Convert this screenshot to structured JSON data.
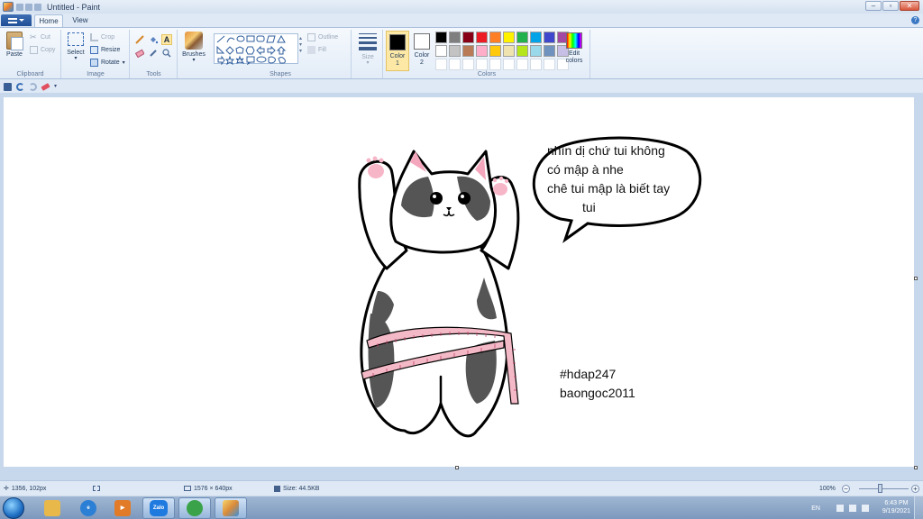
{
  "window": {
    "title": "Untitled - Paint",
    "controls": {
      "minimize": "–",
      "maximize": "▫",
      "close": "✕"
    }
  },
  "tabs": {
    "home": "Home",
    "view": "View"
  },
  "ribbon": {
    "clipboard": {
      "paste": "Paste",
      "cut": "Cut",
      "copy": "Copy",
      "label": "Clipboard"
    },
    "image": {
      "select": "Select",
      "crop": "Crop",
      "resize": "Resize",
      "rotate": "Rotate",
      "label": "Image"
    },
    "tools": {
      "label": "Tools",
      "text_tool": "A"
    },
    "brushes": {
      "label": "Brushes"
    },
    "shapes": {
      "outline": "Outline",
      "fill": "Fill",
      "label": "Shapes"
    },
    "size": {
      "label": "Size"
    },
    "colors": {
      "color1": "Color 1",
      "color2": "Color 2",
      "edit": "Edit colors",
      "label": "Colors",
      "color1_value": "#000000",
      "color2_value": "#ffffff",
      "palette": [
        "#000000",
        "#7f7f7f",
        "#880015",
        "#ed1c24",
        "#ff7f27",
        "#fff200",
        "#22b14c",
        "#00a2e8",
        "#3f48cc",
        "#a349a4",
        "#ffffff",
        "#c3c3c3",
        "#b97a57",
        "#ffaec9",
        "#ffc90e",
        "#efe4b0",
        "#b5e61d",
        "#99d9ea",
        "#7092be",
        "#c8bfe7",
        "#ffffff",
        "#ffffff",
        "#ffffff",
        "#ffffff",
        "#ffffff",
        "#ffffff",
        "#ffffff",
        "#ffffff",
        "#ffffff",
        "#ffffff"
      ]
    }
  },
  "canvas": {
    "bubble_lines": [
      "nhìn dị chứ tui không",
      "có mập à nhe",
      "chê tui mập là biết tay",
      "tui"
    ],
    "hashtag": "#hdap247",
    "author": "baongoc2011"
  },
  "status": {
    "cursor": "1356, 102px",
    "dimensions": "1576 × 640px",
    "size": "Size: 44.5KB",
    "zoom": "100%"
  },
  "taskbar": {
    "apps": [
      {
        "name": "explorer",
        "label": "",
        "color": "#e8b84a"
      },
      {
        "name": "internet-explorer",
        "label": "",
        "color": "#2b7fd4"
      },
      {
        "name": "media-player",
        "label": "",
        "color": "#e27b28"
      },
      {
        "name": "zalo",
        "label": "Zalo",
        "color": "#1f7ae0"
      },
      {
        "name": "browser",
        "label": "",
        "color": "#3aa34a"
      },
      {
        "name": "paint",
        "label": "",
        "color": "#d98b3a"
      }
    ],
    "lang": "EN",
    "time": "6:43 PM",
    "date": "9/19/2021"
  }
}
